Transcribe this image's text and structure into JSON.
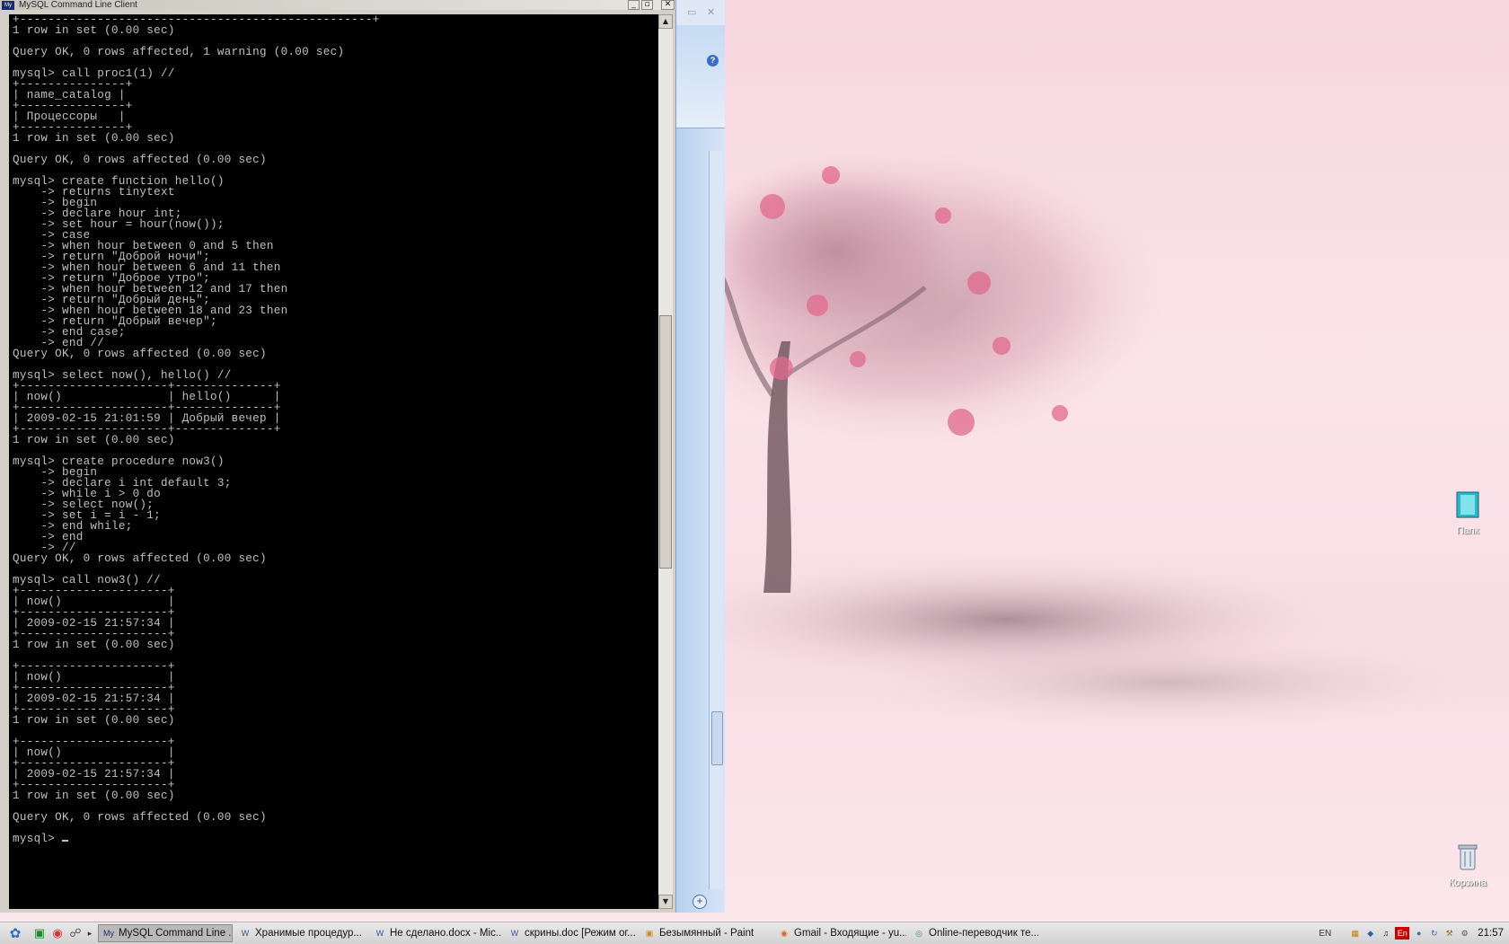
{
  "console": {
    "title": "MySQL Command Line Client",
    "lines": [
      "+--------------------------------------------------+",
      "1 row in set (0.00 sec)",
      "",
      "Query OK, 0 rows affected, 1 warning (0.00 sec)",
      "",
      "mysql> call proc1(1) //",
      "+---------------+",
      "| name_catalog |",
      "+---------------+",
      "| Процессоры   |",
      "+---------------+",
      "1 row in set (0.00 sec)",
      "",
      "Query OK, 0 rows affected (0.00 sec)",
      "",
      "mysql> create function hello()",
      "    -> returns tinytext",
      "    -> begin",
      "    -> declare hour int;",
      "    -> set hour = hour(now());",
      "    -> case",
      "    -> when hour between 0 and 5 then",
      "    -> return \"Доброй ночи\";",
      "    -> when hour between 6 and 11 then",
      "    -> return \"Доброе утро\";",
      "    -> when hour between 12 and 17 then",
      "    -> return \"Добрый день\";",
      "    -> when hour between 18 and 23 then",
      "    -> return \"Добрый вечер\";",
      "    -> end case;",
      "    -> end //",
      "Query OK, 0 rows affected (0.00 sec)",
      "",
      "mysql> select now(), hello() //",
      "+---------------------+--------------+",
      "| now()               | hello()      |",
      "+---------------------+--------------+",
      "| 2009-02-15 21:01:59 | Добрый вечер |",
      "+---------------------+--------------+",
      "1 row in set (0.00 sec)",
      "",
      "mysql> create procedure now3()",
      "    -> begin",
      "    -> declare i int default 3;",
      "    -> while i > 0 do",
      "    -> select now();",
      "    -> set i = i - 1;",
      "    -> end while;",
      "    -> end",
      "    -> //",
      "Query OK, 0 rows affected (0.00 sec)",
      "",
      "mysql> call now3() //",
      "+---------------------+",
      "| now()               |",
      "+---------------------+",
      "| 2009-02-15 21:57:34 |",
      "+---------------------+",
      "1 row in set (0.00 sec)",
      "",
      "+---------------------+",
      "| now()               |",
      "+---------------------+",
      "| 2009-02-15 21:57:34 |",
      "+---------------------+",
      "1 row in set (0.00 sec)",
      "",
      "+---------------------+",
      "| now()               |",
      "+---------------------+",
      "| 2009-02-15 21:57:34 |",
      "+---------------------+",
      "1 row in set (0.00 sec)",
      "",
      "Query OK, 0 rows affected (0.00 sec)",
      ""
    ],
    "prompt": "mysql> "
  },
  "desktop": {
    "icons": [
      {
        "label": "Папк",
        "icon": "folder-icon"
      },
      {
        "label": "Корзина",
        "icon": "recycle-bin-icon"
      }
    ]
  },
  "taskbar": {
    "tasks": [
      {
        "label": "MySQL Command Line ...",
        "icon": "mysql-icon",
        "active": true
      },
      {
        "label": "Хранимые процедур...",
        "icon": "word-icon",
        "active": false
      },
      {
        "label": "Не сделано.docx - Mic...",
        "icon": "word-icon",
        "active": false
      },
      {
        "label": "скрины.doc [Режим ог...",
        "icon": "word-icon",
        "active": false
      },
      {
        "label": "Безымянный - Paint",
        "icon": "paint-icon",
        "active": false
      },
      {
        "label": "Gmail - Входящие - yu...",
        "icon": "firefox-icon",
        "active": false
      },
      {
        "label": "Online-переводчик те...",
        "icon": "chrome-icon",
        "active": false
      }
    ],
    "lang_indicator": "EN",
    "tray_lang": "En",
    "clock": "21:57"
  },
  "colors": {
    "terminal_bg": "#000000",
    "terminal_fg": "#c0c0c0",
    "wallpaper": "#f7dbe3",
    "taskbar": "#d8d8d8"
  }
}
